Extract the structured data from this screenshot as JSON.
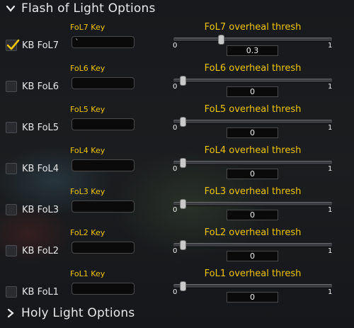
{
  "sections": {
    "flash": {
      "title": "Flash of Light Options",
      "expanded": true
    },
    "holy": {
      "title": "Holy Light Options",
      "expanded": false
    }
  },
  "rows": [
    {
      "checkbox_label": "KB FoL7",
      "checked": true,
      "key_label": "FoL7 Key",
      "key_value": "`",
      "slider_label": "FoL7 overheal thresh",
      "min": "0",
      "max": "1",
      "value": "0.3"
    },
    {
      "checkbox_label": "KB FoL6",
      "checked": false,
      "key_label": "FoL6 Key",
      "key_value": "",
      "slider_label": "FoL6 overheal thresh",
      "min": "0",
      "max": "1",
      "value": "0"
    },
    {
      "checkbox_label": "KB FoL5",
      "checked": false,
      "key_label": "FoL5 Key",
      "key_value": "",
      "slider_label": "FoL5 overheal thresh",
      "min": "0",
      "max": "1",
      "value": "0"
    },
    {
      "checkbox_label": "KB FoL4",
      "checked": false,
      "key_label": "FoL4 Key",
      "key_value": "",
      "slider_label": "FoL4 overheal thresh",
      "min": "0",
      "max": "1",
      "value": "0"
    },
    {
      "checkbox_label": "KB FoL3",
      "checked": false,
      "key_label": "FoL3 Key",
      "key_value": "",
      "slider_label": "FoL3 overheal thresh",
      "min": "0",
      "max": "1",
      "value": "0"
    },
    {
      "checkbox_label": "KB FoL2",
      "checked": false,
      "key_label": "FoL2 Key",
      "key_value": "",
      "slider_label": "FoL2 overheal thresh",
      "min": "0",
      "max": "1",
      "value": "0"
    },
    {
      "checkbox_label": "KB FoL1",
      "checked": false,
      "key_label": "FoL1 Key",
      "key_value": "",
      "slider_label": "FoL1 overheal thresh",
      "min": "0",
      "max": "1",
      "value": "0"
    }
  ],
  "colors": {
    "accent_yellow": "#f0c400",
    "text": "#e6e6e6"
  }
}
